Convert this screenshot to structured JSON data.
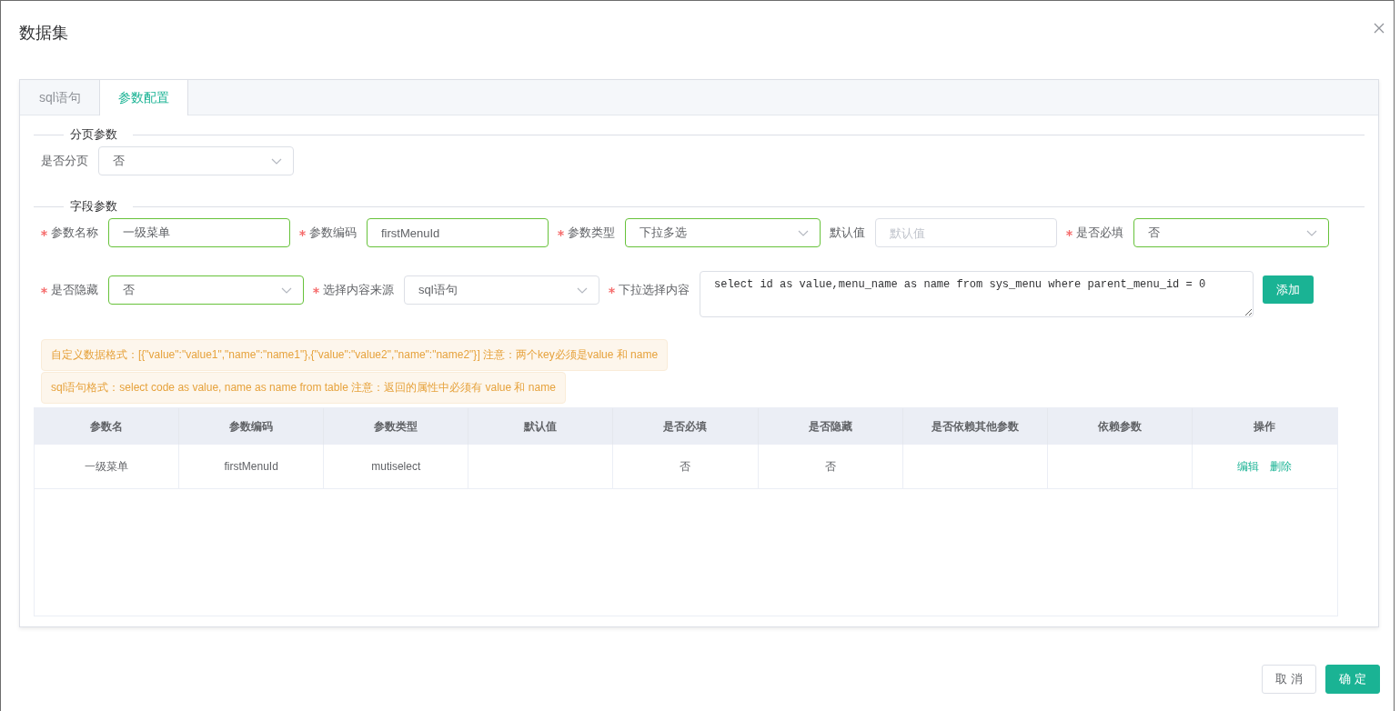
{
  "dialog": {
    "title": "数据集"
  },
  "tabs": [
    {
      "label": "sql语句",
      "selected": false
    },
    {
      "label": "参数配置",
      "selected": true
    }
  ],
  "paging_section": {
    "title": "分页参数",
    "fields": [
      {
        "label": "是否分页",
        "required": false,
        "kind": "select",
        "value": "否",
        "valid": false
      }
    ]
  },
  "field_section": {
    "title": "字段参数",
    "rows": [
      [
        {
          "label": "参数名称",
          "required": true,
          "kind": "input",
          "value": "一级菜单",
          "valid": true
        },
        {
          "label": "参数编码",
          "required": true,
          "kind": "input",
          "value": "firstMenuId",
          "valid": true
        },
        {
          "label": "参数类型",
          "required": true,
          "kind": "select",
          "value": "下拉多选",
          "valid": true
        },
        {
          "label": "默认值",
          "required": false,
          "kind": "input",
          "placeholder": "默认值",
          "valid": false
        },
        {
          "label": "是否必填",
          "required": true,
          "kind": "select",
          "value": "否",
          "valid": true
        }
      ],
      [
        {
          "label": "是否隐藏",
          "required": true,
          "kind": "select",
          "value": "否",
          "valid": true
        },
        {
          "label": "选择内容来源",
          "required": true,
          "kind": "select",
          "value": "sql语句",
          "valid": false
        },
        {
          "label": "下拉选择内容",
          "required": true,
          "kind": "textarea",
          "value": "select id as value,menu_name as name from sys_menu where parent_menu_id = 0",
          "valid": false
        }
      ]
    ],
    "add_button": "添加"
  },
  "notices": [
    "自定义数据格式：[{\"value\":\"value1\",\"name\":\"name1\"},{\"value\":\"value2\",\"name\":\"name2\"}] 注意：两个key必须是value 和 name",
    "sql语句格式：select code as value, name as name from table 注意：返回的属性中必须有 value 和 name"
  ],
  "table": {
    "columns": [
      "参数名",
      "参数编码",
      "参数类型",
      "默认值",
      "是否必填",
      "是否隐藏",
      "是否依赖其他参数",
      "依赖参数",
      "操作"
    ],
    "rows": [
      {
        "cells": [
          "一级菜单",
          "firstMenuId",
          "mutiselect",
          "",
          "否",
          "否",
          "",
          ""
        ],
        "actions": [
          "编辑",
          "删除"
        ]
      }
    ]
  },
  "footer_buttons": [
    {
      "label": "取 消",
      "kind": "default"
    },
    {
      "label": "确 定",
      "kind": "primary"
    }
  ]
}
